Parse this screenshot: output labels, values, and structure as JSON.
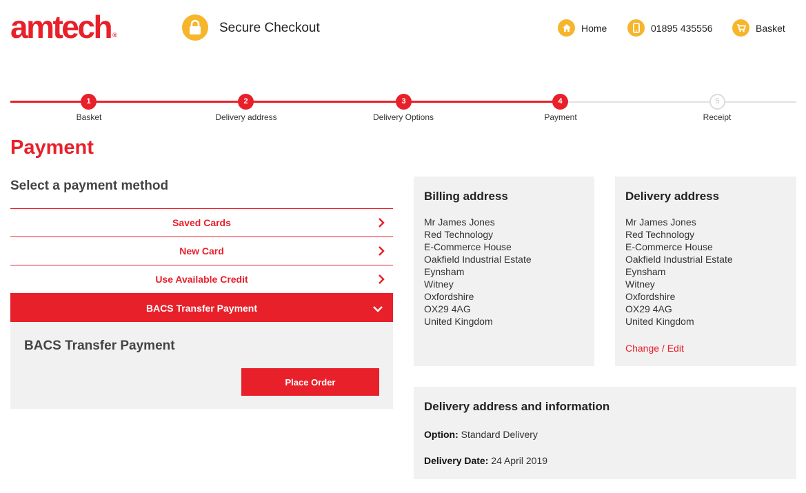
{
  "header": {
    "logo_text": "amtech",
    "logo_mark": "®",
    "secure_label": "Secure Checkout",
    "nav": {
      "home": "Home",
      "phone": "01895 435556",
      "basket": "Basket"
    },
    "icons": [
      "lock-icon",
      "home-icon",
      "phone-icon",
      "basket-icon"
    ]
  },
  "steps": [
    {
      "num": "1",
      "label": "Basket",
      "state": "done"
    },
    {
      "num": "2",
      "label": "Delivery address",
      "state": "done"
    },
    {
      "num": "3",
      "label": "Delivery Options",
      "state": "done"
    },
    {
      "num": "4",
      "label": "Payment",
      "state": "current"
    },
    {
      "num": "5",
      "label": "Receipt",
      "state": "future"
    }
  ],
  "page_title": "Payment",
  "payment": {
    "section_title": "Select a payment method",
    "methods": [
      {
        "label": "Saved Cards"
      },
      {
        "label": "New Card"
      },
      {
        "label": "Use Available Credit"
      },
      {
        "label": "BACS Transfer Payment",
        "expanded": true
      }
    ],
    "panel_title": "BACS Transfer Payment",
    "place_order": "Place Order"
  },
  "billing": {
    "title": "Billing address",
    "lines": [
      "Mr James Jones",
      "Red Technology",
      "E-Commerce House",
      "Oakfield Industrial Estate",
      "Eynsham",
      "Witney",
      "Oxfordshire",
      "OX29 4AG",
      "United Kingdom"
    ]
  },
  "delivery": {
    "title": "Delivery address",
    "lines": [
      "Mr James Jones",
      "Red Technology",
      "E-Commerce House",
      "Oakfield Industrial Estate",
      "Eynsham",
      "Witney",
      "Oxfordshire",
      "OX29 4AG",
      "United Kingdom"
    ],
    "edit_label": "Change / Edit"
  },
  "delivery_info": {
    "title": "Delivery address and information",
    "option_label": "Option:",
    "option_value": "Standard Delivery",
    "date_label": "Delivery Date:",
    "date_value": "24 April 2019"
  },
  "colors": {
    "brand_red": "#e8202a",
    "accent_yellow": "#f6b52a",
    "panel_grey": "#f1f1f1"
  }
}
